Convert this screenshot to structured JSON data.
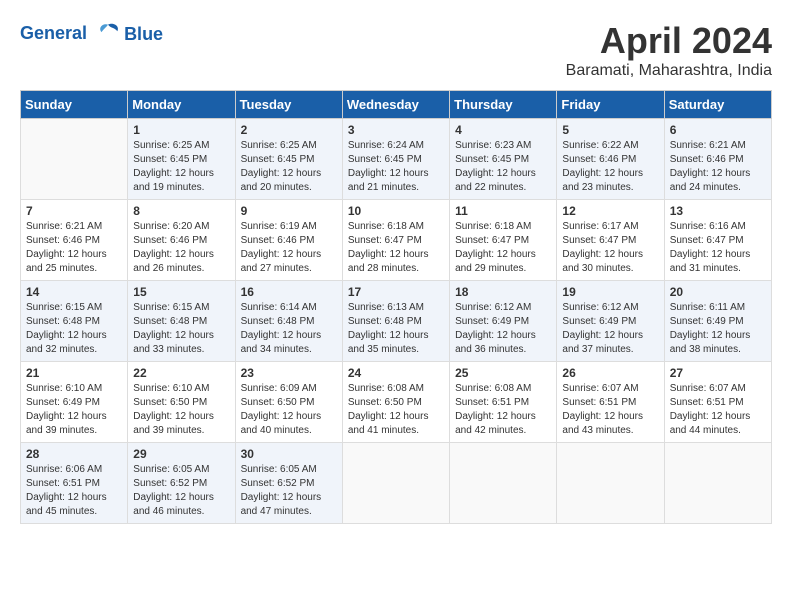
{
  "logo": {
    "line1": "General",
    "line2": "Blue"
  },
  "title": "April 2024",
  "location": "Baramati, Maharashtra, India",
  "days_header": [
    "Sunday",
    "Monday",
    "Tuesday",
    "Wednesday",
    "Thursday",
    "Friday",
    "Saturday"
  ],
  "weeks": [
    [
      {
        "day": "",
        "content": ""
      },
      {
        "day": "1",
        "content": "Sunrise: 6:25 AM\nSunset: 6:45 PM\nDaylight: 12 hours\nand 19 minutes."
      },
      {
        "day": "2",
        "content": "Sunrise: 6:25 AM\nSunset: 6:45 PM\nDaylight: 12 hours\nand 20 minutes."
      },
      {
        "day": "3",
        "content": "Sunrise: 6:24 AM\nSunset: 6:45 PM\nDaylight: 12 hours\nand 21 minutes."
      },
      {
        "day": "4",
        "content": "Sunrise: 6:23 AM\nSunset: 6:45 PM\nDaylight: 12 hours\nand 22 minutes."
      },
      {
        "day": "5",
        "content": "Sunrise: 6:22 AM\nSunset: 6:46 PM\nDaylight: 12 hours\nand 23 minutes."
      },
      {
        "day": "6",
        "content": "Sunrise: 6:21 AM\nSunset: 6:46 PM\nDaylight: 12 hours\nand 24 minutes."
      }
    ],
    [
      {
        "day": "7",
        "content": "Sunrise: 6:21 AM\nSunset: 6:46 PM\nDaylight: 12 hours\nand 25 minutes."
      },
      {
        "day": "8",
        "content": "Sunrise: 6:20 AM\nSunset: 6:46 PM\nDaylight: 12 hours\nand 26 minutes."
      },
      {
        "day": "9",
        "content": "Sunrise: 6:19 AM\nSunset: 6:46 PM\nDaylight: 12 hours\nand 27 minutes."
      },
      {
        "day": "10",
        "content": "Sunrise: 6:18 AM\nSunset: 6:47 PM\nDaylight: 12 hours\nand 28 minutes."
      },
      {
        "day": "11",
        "content": "Sunrise: 6:18 AM\nSunset: 6:47 PM\nDaylight: 12 hours\nand 29 minutes."
      },
      {
        "day": "12",
        "content": "Sunrise: 6:17 AM\nSunset: 6:47 PM\nDaylight: 12 hours\nand 30 minutes."
      },
      {
        "day": "13",
        "content": "Sunrise: 6:16 AM\nSunset: 6:47 PM\nDaylight: 12 hours\nand 31 minutes."
      }
    ],
    [
      {
        "day": "14",
        "content": "Sunrise: 6:15 AM\nSunset: 6:48 PM\nDaylight: 12 hours\nand 32 minutes."
      },
      {
        "day": "15",
        "content": "Sunrise: 6:15 AM\nSunset: 6:48 PM\nDaylight: 12 hours\nand 33 minutes."
      },
      {
        "day": "16",
        "content": "Sunrise: 6:14 AM\nSunset: 6:48 PM\nDaylight: 12 hours\nand 34 minutes."
      },
      {
        "day": "17",
        "content": "Sunrise: 6:13 AM\nSunset: 6:48 PM\nDaylight: 12 hours\nand 35 minutes."
      },
      {
        "day": "18",
        "content": "Sunrise: 6:12 AM\nSunset: 6:49 PM\nDaylight: 12 hours\nand 36 minutes."
      },
      {
        "day": "19",
        "content": "Sunrise: 6:12 AM\nSunset: 6:49 PM\nDaylight: 12 hours\nand 37 minutes."
      },
      {
        "day": "20",
        "content": "Sunrise: 6:11 AM\nSunset: 6:49 PM\nDaylight: 12 hours\nand 38 minutes."
      }
    ],
    [
      {
        "day": "21",
        "content": "Sunrise: 6:10 AM\nSunset: 6:49 PM\nDaylight: 12 hours\nand 39 minutes."
      },
      {
        "day": "22",
        "content": "Sunrise: 6:10 AM\nSunset: 6:50 PM\nDaylight: 12 hours\nand 39 minutes."
      },
      {
        "day": "23",
        "content": "Sunrise: 6:09 AM\nSunset: 6:50 PM\nDaylight: 12 hours\nand 40 minutes."
      },
      {
        "day": "24",
        "content": "Sunrise: 6:08 AM\nSunset: 6:50 PM\nDaylight: 12 hours\nand 41 minutes."
      },
      {
        "day": "25",
        "content": "Sunrise: 6:08 AM\nSunset: 6:51 PM\nDaylight: 12 hours\nand 42 minutes."
      },
      {
        "day": "26",
        "content": "Sunrise: 6:07 AM\nSunset: 6:51 PM\nDaylight: 12 hours\nand 43 minutes."
      },
      {
        "day": "27",
        "content": "Sunrise: 6:07 AM\nSunset: 6:51 PM\nDaylight: 12 hours\nand 44 minutes."
      }
    ],
    [
      {
        "day": "28",
        "content": "Sunrise: 6:06 AM\nSunset: 6:51 PM\nDaylight: 12 hours\nand 45 minutes."
      },
      {
        "day": "29",
        "content": "Sunrise: 6:05 AM\nSunset: 6:52 PM\nDaylight: 12 hours\nand 46 minutes."
      },
      {
        "day": "30",
        "content": "Sunrise: 6:05 AM\nSunset: 6:52 PM\nDaylight: 12 hours\nand 47 minutes."
      },
      {
        "day": "",
        "content": ""
      },
      {
        "day": "",
        "content": ""
      },
      {
        "day": "",
        "content": ""
      },
      {
        "day": "",
        "content": ""
      }
    ]
  ]
}
